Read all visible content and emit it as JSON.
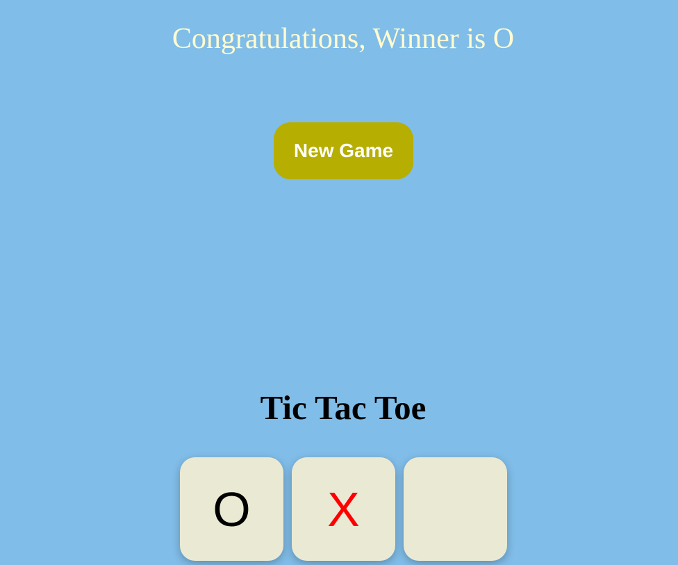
{
  "status": {
    "winner_message": "Congratulations, Winner is O"
  },
  "controls": {
    "new_game_label": "New Game"
  },
  "title": "Tic Tac Toe",
  "board": {
    "visible_row": [
      "O",
      "X",
      ""
    ]
  },
  "colors": {
    "background": "#80bde8",
    "message_text": "#fffbd1",
    "button_bg": "#b6ae00",
    "button_text": "#ffffff",
    "cell_bg": "#eaead4",
    "mark_o": "#000000",
    "mark_x": "#ff0000"
  }
}
